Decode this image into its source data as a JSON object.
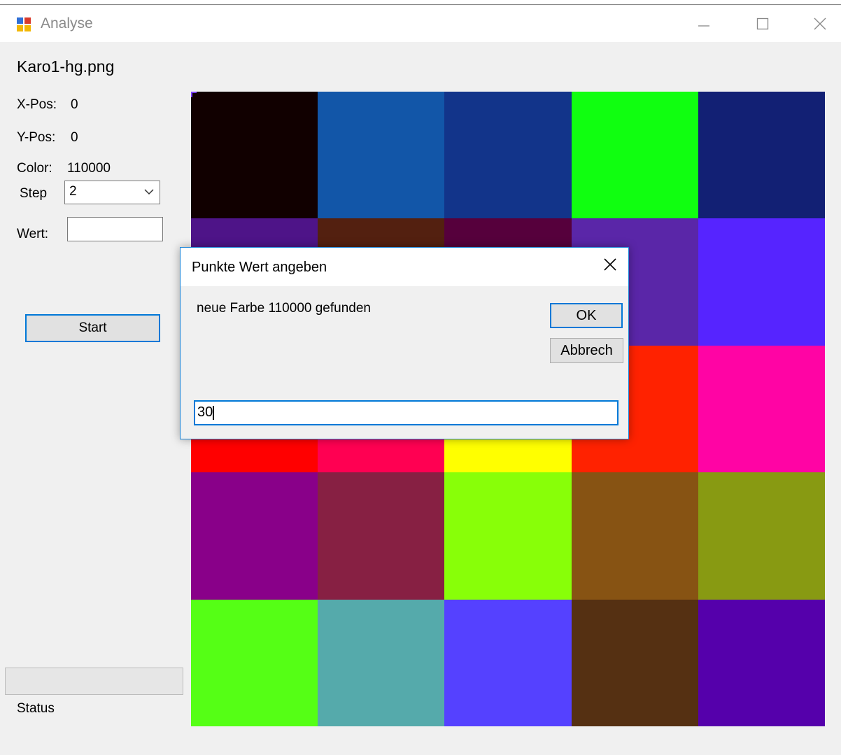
{
  "window": {
    "title": "Analyse",
    "controls": {
      "minimize_icon": "minimize-icon",
      "maximize_icon": "maximize-icon",
      "close_icon": "close-icon"
    }
  },
  "panel": {
    "filename": "Karo1-hg.png",
    "xpos": {
      "label": "X-Pos:",
      "value": "0"
    },
    "ypos": {
      "label": "Y-Pos:",
      "value": "0"
    },
    "color": {
      "label": "Color:",
      "value": "110000"
    },
    "step": {
      "label": "Step",
      "value": "2"
    },
    "wert": {
      "label": "Wert:",
      "value": ""
    },
    "start_label": "Start",
    "progress_percent": 0,
    "status_label": "Status"
  },
  "image_grid": {
    "columns": 5,
    "rows": 5,
    "colors": [
      "#110000",
      "#1256a8",
      "#12348a",
      "#10ff10",
      "#122074",
      "#4e1488",
      "#532010",
      "#56003c",
      "#5a26a8",
      "#5624ff",
      "#d40000",
      "#d40028",
      "#e0d400",
      "#ff2200",
      "#ff04a4",
      "#ff0000",
      "#ff0052",
      "#ffff00",
      "#ff2200",
      "#ff04a4",
      "#890089",
      "#872043",
      "#88ff08",
      "#875313",
      "#889a12",
      "#55ff15",
      "#55aaab",
      "#5541ff",
      "#553012",
      "#5500ab"
    ]
  },
  "dialog": {
    "title": "Punkte Wert angeben",
    "message": "neue Farbe 110000 gefunden",
    "ok_label": "OK",
    "cancel_label": "Abbrech",
    "input_value": "30"
  },
  "colors": {
    "accent": "#0078d7",
    "window_bg": "#f0f0f0",
    "button_bg": "#e1e1e1"
  }
}
